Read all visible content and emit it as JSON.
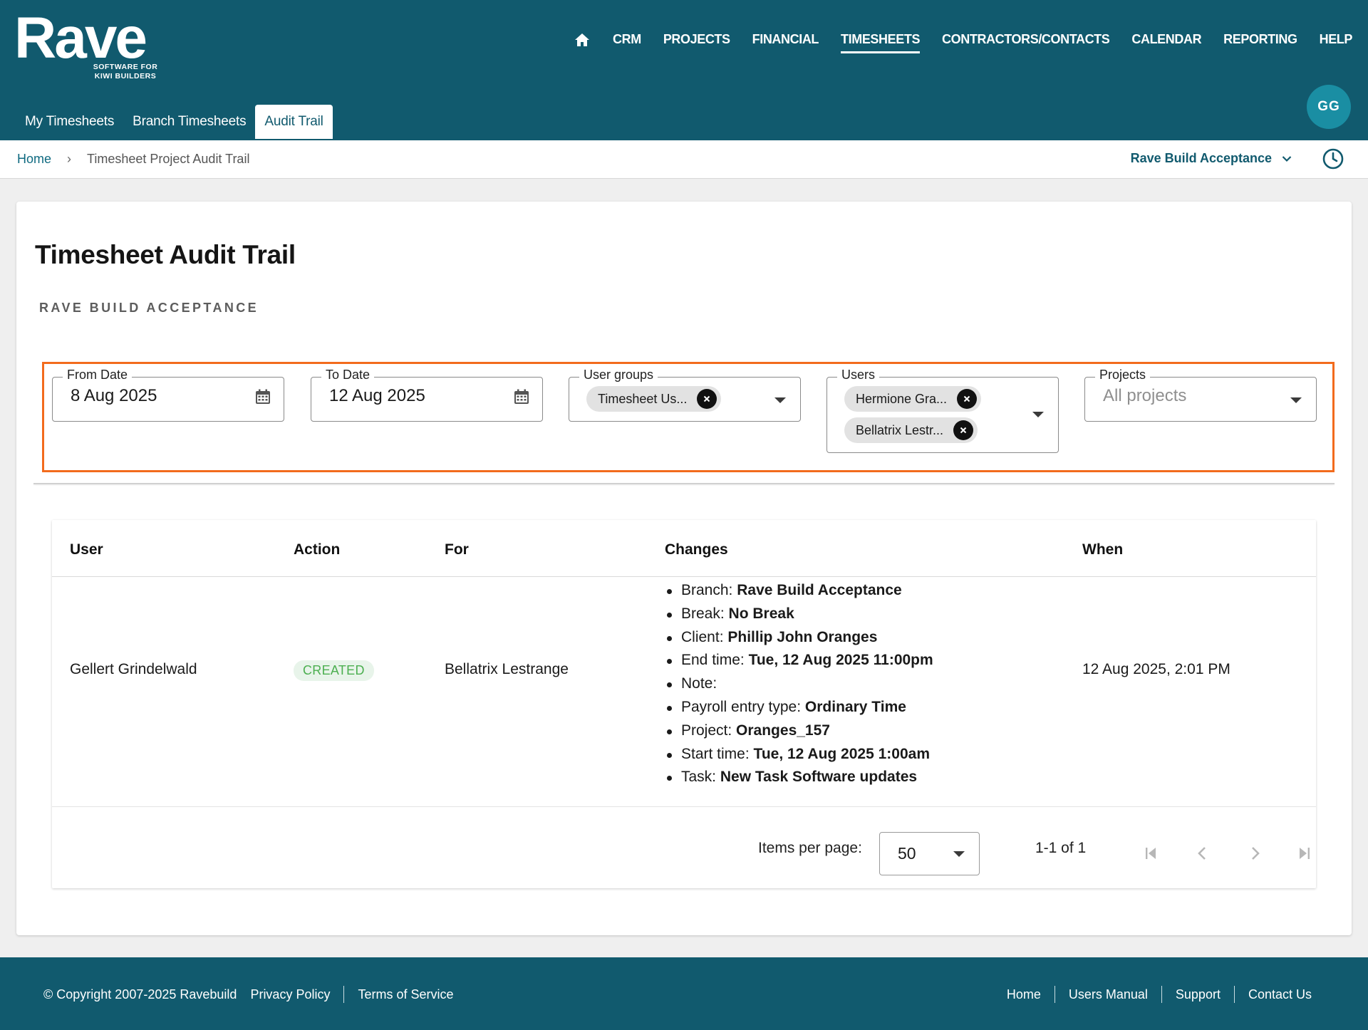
{
  "brand": {
    "name": "Rave",
    "tagline_line1": "SOFTWARE FOR",
    "tagline_line2": "KIWI BUILDERS"
  },
  "nav": {
    "items": [
      {
        "label": "CRM"
      },
      {
        "label": "PROJECTS"
      },
      {
        "label": "FINANCIAL"
      },
      {
        "label": "TIMESHEETS",
        "active": true
      },
      {
        "label": "CONTRACTORS/CONTACTS"
      },
      {
        "label": "CALENDAR"
      },
      {
        "label": "REPORTING"
      },
      {
        "label": "HELP"
      }
    ]
  },
  "subtabs": [
    {
      "label": "My Timesheets"
    },
    {
      "label": "Branch Timesheets"
    },
    {
      "label": "Audit Trail",
      "active": true
    }
  ],
  "user": {
    "initials": "GG"
  },
  "breadcrumb": {
    "home": "Home",
    "current": "Timesheet Project Audit Trail"
  },
  "branch_selector": {
    "value": "Rave Build Acceptance"
  },
  "page": {
    "title": "Timesheet Audit Trail",
    "subtitle": "RAVE BUILD ACCEPTANCE"
  },
  "filters": {
    "from_date": {
      "label": "From Date",
      "value": "8 Aug 2025"
    },
    "to_date": {
      "label": "To Date",
      "value": "12 Aug 2025"
    },
    "user_groups": {
      "label": "User groups",
      "chips": [
        "Timesheet Us..."
      ]
    },
    "users": {
      "label": "Users",
      "chips": [
        "Hermione Gra...",
        "Bellatrix Lestr..."
      ]
    },
    "projects": {
      "label": "Projects",
      "placeholder": "All projects"
    }
  },
  "table": {
    "columns": [
      "User",
      "Action",
      "For",
      "Changes",
      "When"
    ],
    "rows": [
      {
        "user": "Gellert Grindelwald",
        "action": "CREATED",
        "for": "Bellatrix Lestrange",
        "when": "12 Aug 2025, 2:01 PM",
        "changes": [
          {
            "key": "Branch:",
            "value": "Rave Build Acceptance"
          },
          {
            "key": "Break:",
            "value": "No Break"
          },
          {
            "key": "Client:",
            "value": "Phillip John Oranges"
          },
          {
            "key": "End time:",
            "value": "Tue, 12 Aug 2025 11:00pm"
          },
          {
            "key": "Note:",
            "value": ""
          },
          {
            "key": "Payroll entry type:",
            "value": "Ordinary Time"
          },
          {
            "key": "Project:",
            "value": "Oranges_157"
          },
          {
            "key": "Start time:",
            "value": "Tue, 12 Aug 2025 1:00am"
          },
          {
            "key": "Task:",
            "value": "New Task Software updates"
          }
        ]
      }
    ]
  },
  "pagination": {
    "items_per_page_label": "Items per page:",
    "items_per_page": "50",
    "range": "1-1 of 1"
  },
  "footer": {
    "copyright": "© Copyright 2007-2025 Ravebuild",
    "left_links": [
      "Privacy Policy",
      "Terms of Service"
    ],
    "right_links": [
      "Home",
      "Users Manual",
      "Support",
      "Contact Us"
    ]
  },
  "colors": {
    "header": "#115a6e",
    "accent": "#f26b1d",
    "avatar": "#1a8ea3",
    "badge_text": "#4caf50"
  }
}
